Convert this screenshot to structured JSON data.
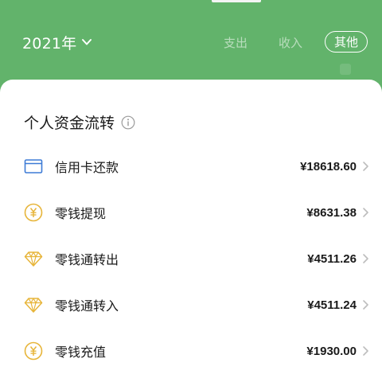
{
  "header": {
    "year": "2021年",
    "filters": [
      {
        "label": "支出"
      },
      {
        "label": "收入"
      },
      {
        "label": "其他"
      }
    ]
  },
  "section": {
    "title": "个人资金流转"
  },
  "rows": [
    {
      "label": "信用卡还款",
      "amount": "¥18618.60",
      "icon": "credit-card-icon"
    },
    {
      "label": "零钱提现",
      "amount": "¥8631.38",
      "icon": "yuan-coin-icon"
    },
    {
      "label": "零钱通转出",
      "amount": "¥4511.26",
      "icon": "diamond-icon"
    },
    {
      "label": "零钱通转入",
      "amount": "¥4511.24",
      "icon": "diamond-icon"
    },
    {
      "label": "零钱充值",
      "amount": "¥1930.00",
      "icon": "yuan-coin-icon"
    }
  ],
  "colors": {
    "header_bg": "#62b36b",
    "icon_blue": "#3d7bd6",
    "icon_gold": "#e7b53a"
  }
}
